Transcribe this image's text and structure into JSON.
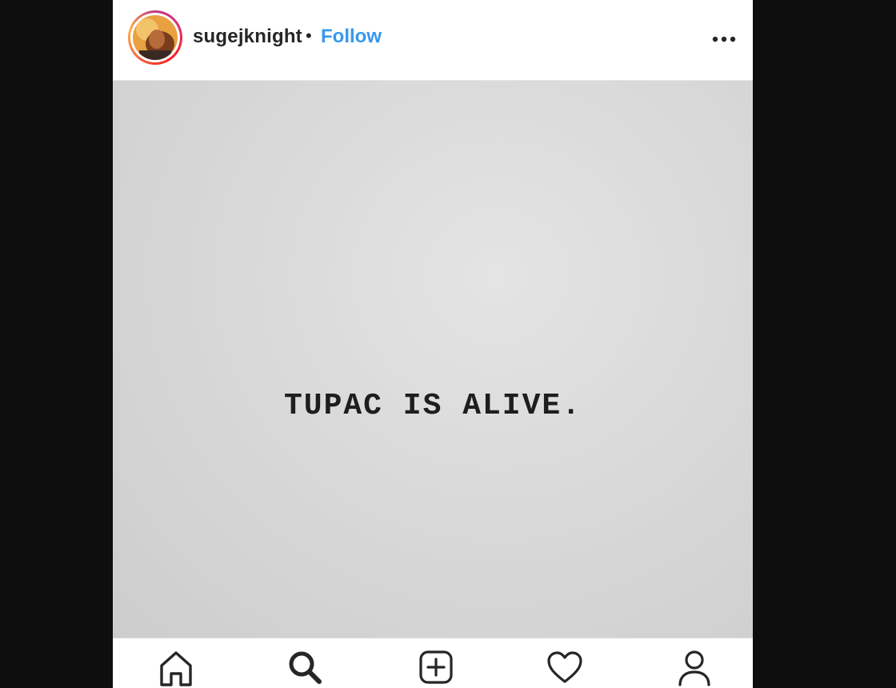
{
  "post": {
    "username": "sugejknight",
    "separator": "•",
    "follow_label": "Follow",
    "more_icon": "more-horizontal-icon",
    "image_text": "TUPAC IS ALIVE."
  },
  "nav": {
    "items": [
      {
        "icon": "home-icon"
      },
      {
        "icon": "search-icon"
      },
      {
        "icon": "new-post-icon"
      },
      {
        "icon": "heart-icon"
      },
      {
        "icon": "profile-icon"
      }
    ]
  },
  "colors": {
    "follow": "#3897f0",
    "page_bg": "#0e0e0e",
    "post_bg": "#d9d9d9",
    "text": "#262626"
  }
}
